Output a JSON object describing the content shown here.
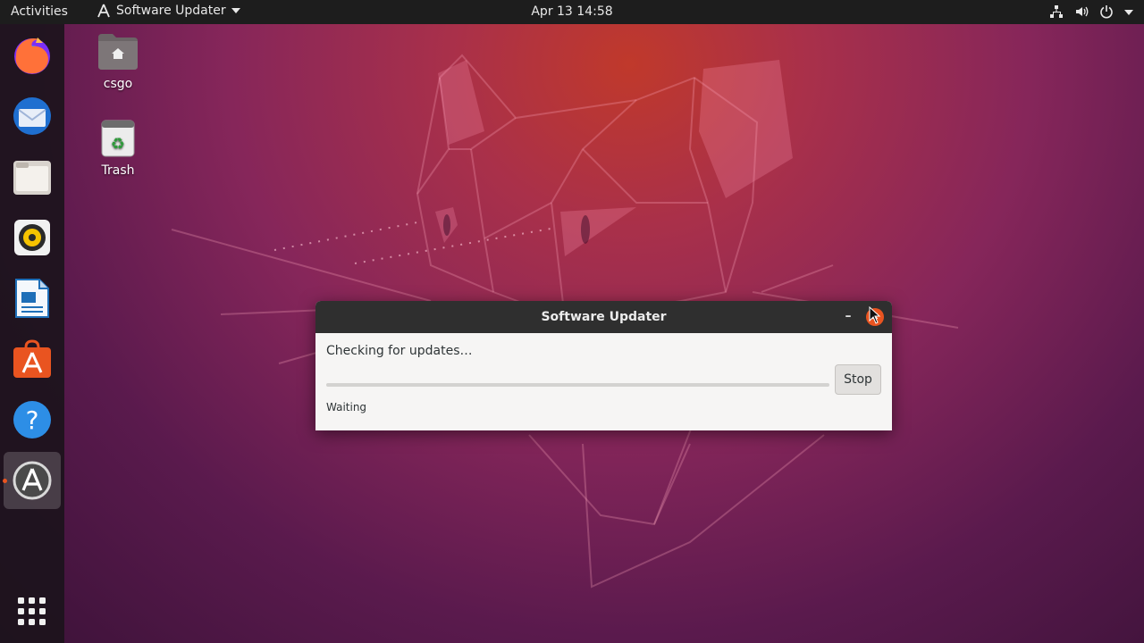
{
  "topbar": {
    "activities_label": "Activities",
    "app_menu_label": "Software Updater",
    "clock": "Apr 13  14:58"
  },
  "dock": {
    "items": [
      {
        "name": "Firefox"
      },
      {
        "name": "Thunderbird"
      },
      {
        "name": "Files"
      },
      {
        "name": "Rhythmbox"
      },
      {
        "name": "LibreOffice Writer"
      },
      {
        "name": "Ubuntu Software"
      },
      {
        "name": "Help"
      },
      {
        "name": "Software Updater",
        "active": true
      }
    ]
  },
  "desktop": {
    "icons": [
      {
        "label": "csgo"
      },
      {
        "label": "Trash"
      }
    ]
  },
  "dialog": {
    "title": "Software Updater",
    "minimize_glyph": "–",
    "close_glyph": "✕",
    "status": "Checking for updates…",
    "stop_label": "Stop",
    "substatus": "Waiting",
    "progress": 0
  },
  "colors": {
    "accent": "#e95420",
    "topbar": "#1d1d1d",
    "dialog_titlebar": "#2f2f2f"
  }
}
